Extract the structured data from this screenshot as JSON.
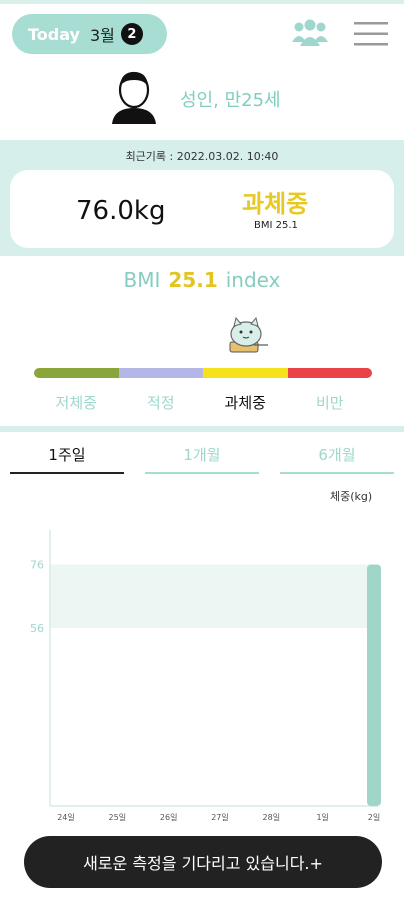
{
  "header": {
    "today_label": "Today",
    "month_label": "3월",
    "badge_count": "2"
  },
  "profile": {
    "label": "성인, 만25세"
  },
  "record": {
    "date": "최근기록 : 2022.03.02. 10:40",
    "weight": "76.0kg",
    "status": "과체중",
    "bmi_sub": "BMI 25.1"
  },
  "bmi": {
    "prefix": "BMI",
    "value": "25.1",
    "suffix": "index"
  },
  "scale": {
    "labels": [
      "저체중",
      "적정",
      "과체중",
      "비만"
    ],
    "colors": [
      "#8aa63b",
      "#b4b6e8",
      "#f5e21a",
      "#e94348"
    ],
    "label_colors": [
      "#9fd7cc",
      "#9fd7cc",
      "#111111",
      "#9fd7cc"
    ],
    "current_index": 2
  },
  "tabs": [
    {
      "label": "1주일",
      "active": true
    },
    {
      "label": "1개월",
      "active": false
    },
    {
      "label": "6개월",
      "active": false
    }
  ],
  "chart_data": {
    "type": "bar",
    "ylabel": "체중(kg)",
    "categories": [
      "24일",
      "25일",
      "26일",
      "27일",
      "28일",
      "1일",
      "2일"
    ],
    "values": [
      null,
      null,
      null,
      null,
      null,
      null,
      76.0
    ],
    "y_ticks": [
      76,
      56
    ],
    "normal_range": [
      56,
      76
    ],
    "ylim": [
      0,
      90
    ],
    "bar_color": "#9fd6c8",
    "band_color": "#ecf7f4"
  },
  "cta": {
    "label": "새로운 측정을 기다리고 있습니다.+"
  },
  "colors": {
    "accent": "#a8ddd3",
    "accent_text": "#86cdbf",
    "status_yellow": "#e7c923"
  }
}
